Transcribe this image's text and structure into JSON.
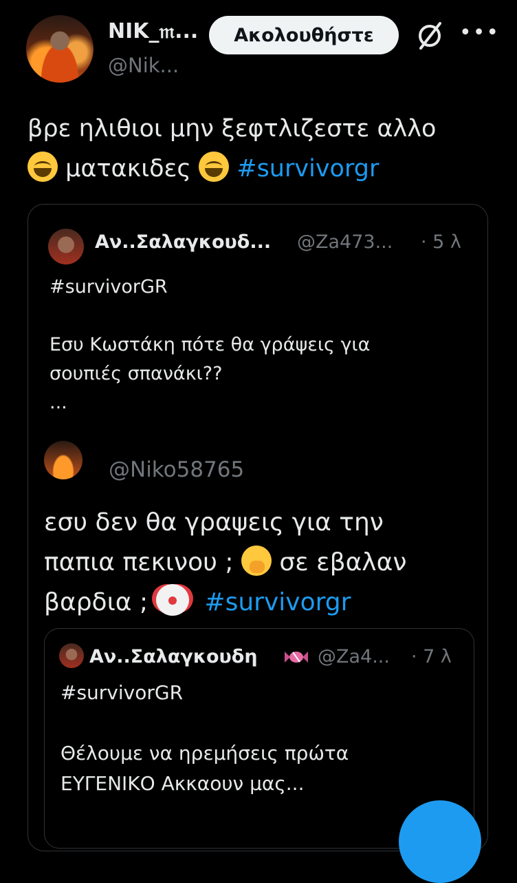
{
  "header": {
    "name": "ΝΙΚ_𝔪...",
    "handle": "@Nik...",
    "follow_label": "Ακολουθήστε"
  },
  "tweet": {
    "text_line1": "βρε ηλιθιοι μην ξεφτλιζεστε αλλο",
    "text_part2": "ματακιδες",
    "hashtag": "#survivorgr"
  },
  "quote": {
    "name": "Αν..Σαλαγκουδ...",
    "handle": "@Za473...",
    "time": "· 5 λ",
    "text": "#survivorGR\n\nΕσυ Κωστάκη πότε θα γράψεις για\nσουπιές σπανάκι??\n..."
  },
  "image_reply": {
    "handle": "@Niko58765",
    "line1": "εσυ δεν θα γραψεις για την",
    "line2": "παπια πεκινου ;",
    "line2b": "σε εβαλαν",
    "line3": "βαρδια ;",
    "hashtag": "#survivorgr"
  },
  "inner_quote": {
    "name": "Αν..Σαλαγκουδη",
    "handle": "@Za4...",
    "time": "· 7 λ",
    "text": "#survivorGR\n\nΘέλουμε να ηρεμήσεις πρώτα\nΕΥΓΕΝΙΚΟ Ακκαουν μας..."
  },
  "colors": {
    "background": "#000000",
    "text": "#e7e9ea",
    "muted": "#71767b",
    "link": "#1d9bf0",
    "border": "#2f3336"
  }
}
